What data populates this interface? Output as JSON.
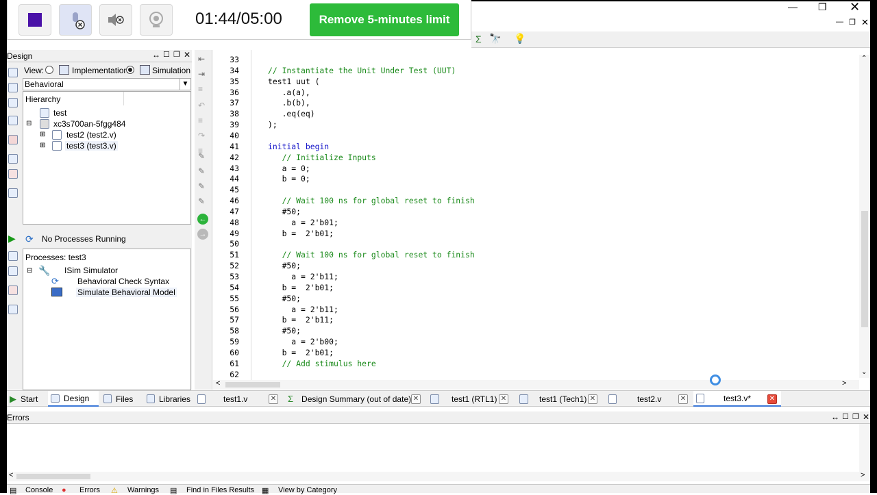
{
  "recorder": {
    "timer": "01:44/05:00",
    "remove_limit_label": "Remove 5-minutes limit"
  },
  "design_panel": {
    "title": "Design",
    "view_label": "View:",
    "implementation_label": "Implementation",
    "simulation_label": "Simulation",
    "behavioral_value": "Behavioral",
    "hierarchy_label": "Hierarchy",
    "tree": {
      "test": "test",
      "device": "xc3s700an-5fgg484",
      "test2": "test2 (test2.v)",
      "test3": "test3 (test3.v)"
    },
    "process_status": "No Processes Running",
    "processes_label": "Processes: test3",
    "isim": "ISim Simulator",
    "check_syntax": "Behavioral Check Syntax",
    "simulate": "Simulate Behavioral Model"
  },
  "editor": {
    "lines": [
      {
        "n": "33",
        "text": "",
        "cls": ""
      },
      {
        "n": "34",
        "text": "// Instantiate the Unit Under Test (UUT)",
        "cls": "cmt"
      },
      {
        "n": "35",
        "text": "test1 uut (",
        "cls": ""
      },
      {
        "n": "36",
        "text": "   .a(a),",
        "cls": ""
      },
      {
        "n": "37",
        "text": "   .b(b),",
        "cls": ""
      },
      {
        "n": "38",
        "text": "   .eq(eq)",
        "cls": ""
      },
      {
        "n": "39",
        "text": ");",
        "cls": ""
      },
      {
        "n": "40",
        "text": "",
        "cls": ""
      },
      {
        "n": "41",
        "text": "initial begin",
        "cls": "kw"
      },
      {
        "n": "42",
        "text": "   // Initialize Inputs",
        "cls": "cmt"
      },
      {
        "n": "43",
        "text": "   a = 0;",
        "cls": ""
      },
      {
        "n": "44",
        "text": "   b = 0;",
        "cls": ""
      },
      {
        "n": "45",
        "text": "",
        "cls": ""
      },
      {
        "n": "46",
        "text": "   // Wait 100 ns for global reset to finish",
        "cls": "cmt"
      },
      {
        "n": "47",
        "text": "   #50;",
        "cls": ""
      },
      {
        "n": "48",
        "text": "     a = 2'b01;",
        "cls": ""
      },
      {
        "n": "49",
        "text": "   b =  2'b01;",
        "cls": ""
      },
      {
        "n": "50",
        "text": "",
        "cls": ""
      },
      {
        "n": "51",
        "text": "   // Wait 100 ns for global reset to finish",
        "cls": "cmt"
      },
      {
        "n": "52",
        "text": "   #50;",
        "cls": ""
      },
      {
        "n": "53",
        "text": "     a = 2'b11;",
        "cls": ""
      },
      {
        "n": "54",
        "text": "   b =  2'b01;",
        "cls": ""
      },
      {
        "n": "55",
        "text": "   #50;",
        "cls": ""
      },
      {
        "n": "56",
        "text": "     a = 2'b11;",
        "cls": ""
      },
      {
        "n": "57",
        "text": "   b =  2'b11;",
        "cls": ""
      },
      {
        "n": "58",
        "text": "   #50;",
        "cls": ""
      },
      {
        "n": "59",
        "text": "     a = 2'b00;",
        "cls": ""
      },
      {
        "n": "60",
        "text": "   b =  2'b01;",
        "cls": ""
      },
      {
        "n": "61",
        "text": "   // Add stimulus here",
        "cls": "cmt"
      },
      {
        "n": "62",
        "text": "",
        "cls": ""
      }
    ]
  },
  "left_tabs": {
    "start": "Start",
    "design": "Design",
    "files": "Files",
    "libraries": "Libraries"
  },
  "editor_tabs": [
    {
      "label": "test1.v",
      "icon": "document-icon"
    },
    {
      "label": "Design Summary (out of date)",
      "icon": "sigma-icon"
    },
    {
      "label": "test1 (RTL1)",
      "icon": "schematic-icon"
    },
    {
      "label": "test1 (Tech1)",
      "icon": "schematic-icon"
    },
    {
      "label": "test2.v",
      "icon": "document-icon"
    },
    {
      "label": "test3.v*",
      "icon": "document-icon"
    }
  ],
  "errors_panel": {
    "title": "Errors"
  },
  "bottom_tabs": {
    "console": "Console",
    "errors": "Errors",
    "warnings": "Warnings",
    "find": "Find in Files Results",
    "category": "View by Category"
  },
  "colors": {
    "remove_button": "#2dbb3a",
    "comment": "#1a8a1a",
    "keyword": "#1414c8",
    "stop_square": "#4a12a8"
  }
}
